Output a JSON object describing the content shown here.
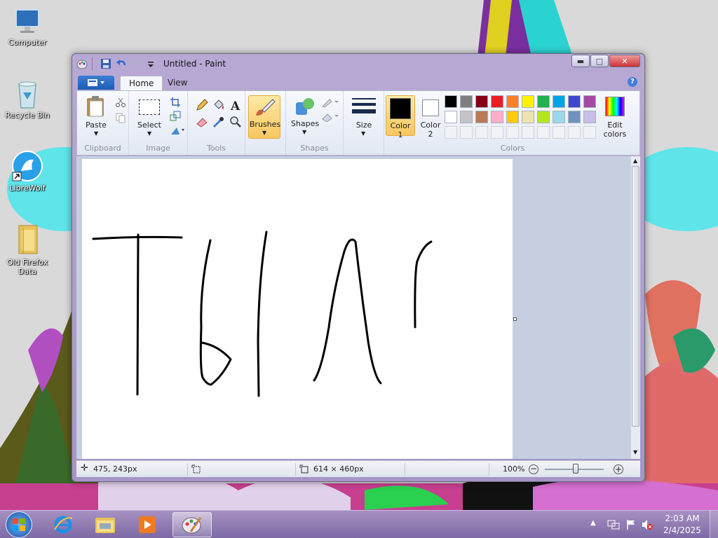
{
  "desktop": {
    "icons": [
      {
        "label": "Computer",
        "icon": "computer-icon"
      },
      {
        "label": "Recycle Bin",
        "icon": "recycle-bin-icon"
      },
      {
        "label": "LibreWolf",
        "icon": "librewolf-icon"
      },
      {
        "label": "Old Firefox Data",
        "icon": "folder-icon"
      }
    ]
  },
  "window": {
    "title": "Untitled - Paint",
    "tabs": [
      {
        "label": "Home",
        "active": true
      },
      {
        "label": "View",
        "active": false
      }
    ]
  },
  "ribbon": {
    "clipboard": {
      "paste": "Paste",
      "group": "Clipboard"
    },
    "image": {
      "select": "Select",
      "group": "Image"
    },
    "tools": {
      "group": "Tools"
    },
    "brushes": {
      "label": "Brushes"
    },
    "shapes": {
      "label": "Shapes",
      "group": "Shapes"
    },
    "size": {
      "label": "Size"
    },
    "colors": {
      "color1": "Color\n1",
      "color1_line1": "Color",
      "color1_line2": "1",
      "color2_line1": "Color",
      "color2_line2": "2",
      "edit_line1": "Edit",
      "edit_line2": "colors",
      "group": "Colors",
      "palette_row1": [
        "#000000",
        "#7f7f7f",
        "#880015",
        "#ed1c24",
        "#ff7f27",
        "#fff200",
        "#22b14c",
        "#00a2e8",
        "#3f48cc",
        "#a349a4"
      ],
      "palette_row2": [
        "#ffffff",
        "#c3c3c3",
        "#b97a57",
        "#ffaec9",
        "#ffc90e",
        "#efe4b0",
        "#b5e61d",
        "#99d9ea",
        "#7092be",
        "#c8bfe7"
      ],
      "color1_value": "#000000",
      "color2_value": "#ffffff"
    }
  },
  "status": {
    "cursor_pos": "475, 243px",
    "canvas_size": "614 × 460px",
    "zoom": "100%"
  },
  "taskbar": {
    "time": "2:03 AM",
    "date": "2/4/2025"
  }
}
